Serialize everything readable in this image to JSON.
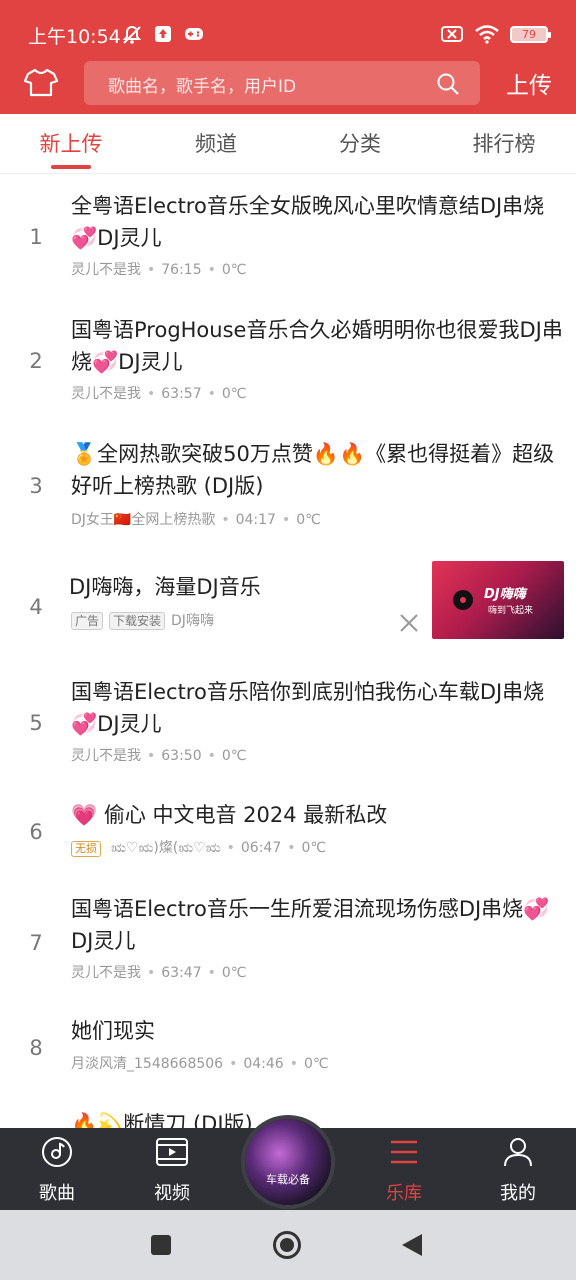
{
  "status_bar": {
    "time": "上午10:54",
    "battery": "79"
  },
  "search": {
    "placeholder": "歌曲名，歌手名，用户ID"
  },
  "header": {
    "upload_label": "上传"
  },
  "tabs": [
    {
      "label": "新上传",
      "active": true
    },
    {
      "label": "频道",
      "active": false
    },
    {
      "label": "分类",
      "active": false
    },
    {
      "label": "排行榜",
      "active": false
    }
  ],
  "songs": [
    {
      "rank": "1",
      "title": "全粤语Electro音乐全女版晚风心里吹情意结DJ串烧💞DJ灵儿",
      "artist": "灵儿不是我",
      "duration": "76:15",
      "temp": "0℃"
    },
    {
      "rank": "2",
      "title": "国粤语ProgHouse音乐合久必婚明明你也很爱我DJ串烧💞DJ灵儿",
      "artist": "灵儿不是我",
      "duration": "63:57",
      "temp": "0℃"
    },
    {
      "rank": "3",
      "title": "🏅全网热歌突破50万点赞🔥🔥《累也得挺着》超级好听上榜热歌 (DJ版)",
      "artist": "DJ女王🇨🇳全网上榜热歌",
      "duration": "04:17",
      "temp": "0℃"
    },
    {
      "rank": "4",
      "title": "DJ嗨嗨，海量DJ音乐",
      "tag_ad": "广告",
      "tag_dl": "下载安装",
      "artist": "DJ嗨嗨",
      "ad_logo": "DJ嗨嗨",
      "ad_slogan": "嗨到飞起来"
    },
    {
      "rank": "5",
      "title": "国粤语Electro音乐陪你到底别怕我伤心车载DJ串烧💞DJ灵儿",
      "artist": "灵儿不是我",
      "duration": "63:50",
      "temp": "0℃"
    },
    {
      "rank": "6",
      "title": "💗 偷心 中文电音 2024 最新私改",
      "tag_lossless": "无损",
      "artist": "ಋ♡ಋ)燦(ಋ♡ಋ",
      "duration": "06:47",
      "temp": "0℃"
    },
    {
      "rank": "7",
      "title": "国粤语Electro音乐一生所爱泪流现场伤感DJ串烧💞DJ灵儿",
      "artist": "灵儿不是我",
      "duration": "63:47",
      "temp": "0℃"
    },
    {
      "rank": "8",
      "title": "她们现实",
      "artist": "月淡风清_1548668506",
      "duration": "04:46",
      "temp": "0℃"
    },
    {
      "rank": "9",
      "title": "🔥💫断情刀 (DJ版)"
    }
  ],
  "bottom_nav": [
    {
      "label": "歌曲",
      "icon": "disc-icon"
    },
    {
      "label": "视频",
      "icon": "video-icon"
    },
    {
      "label": "车载必备",
      "icon": "center-disc"
    },
    {
      "label": "乐库",
      "icon": "menu-lines-icon",
      "active": true
    },
    {
      "label": "我的",
      "icon": "person-icon"
    }
  ],
  "colors": {
    "brand": "#e04341",
    "nav_bg": "#2e3035"
  }
}
